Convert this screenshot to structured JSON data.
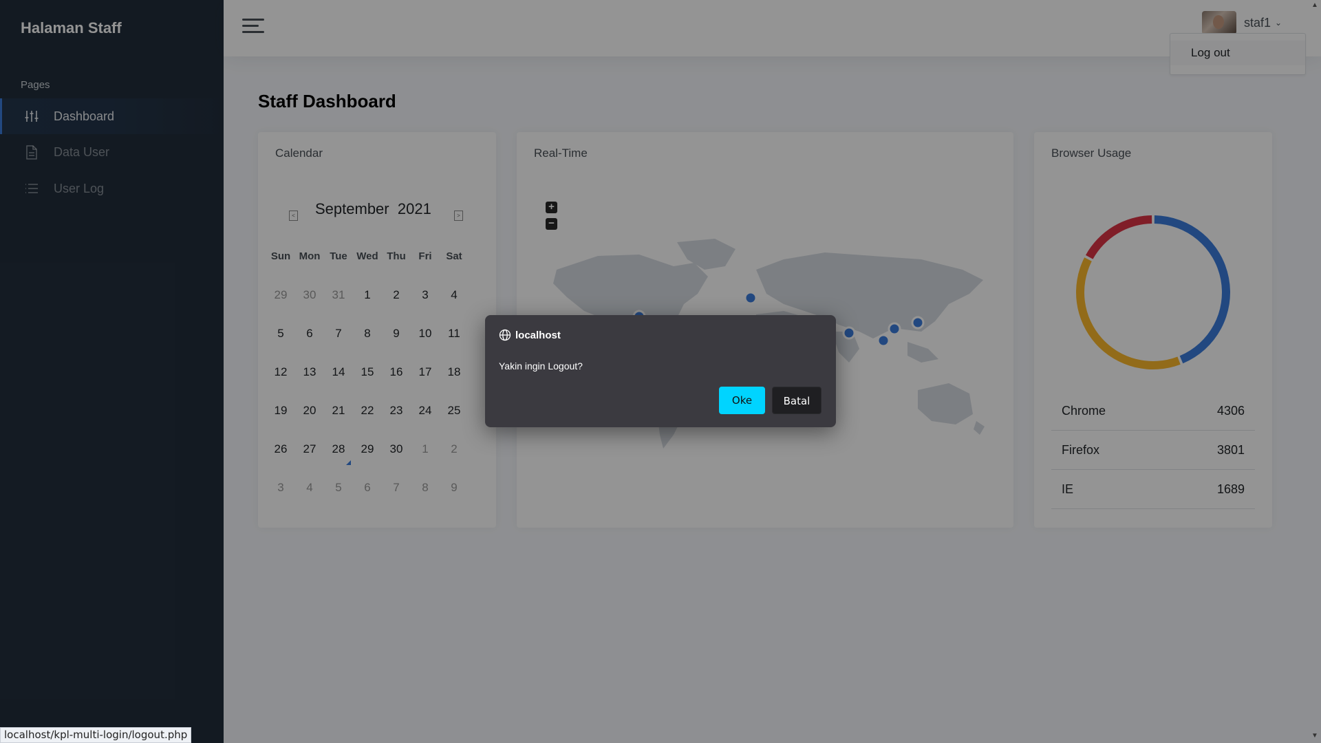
{
  "sidebar": {
    "brand": "Halaman Staff",
    "header": "Pages",
    "items": [
      {
        "label": "Dashboard",
        "icon": "sliders-icon"
      },
      {
        "label": "Data User",
        "icon": "file-icon"
      },
      {
        "label": "User Log",
        "icon": "list-icon"
      }
    ]
  },
  "topbar": {
    "user_name": "staf1",
    "dropdown": {
      "logout_label": "Log out"
    }
  },
  "main": {
    "title_bold": "Staff",
    "title_rest": "Dashboard",
    "calendar": {
      "title": "Calendar",
      "month": "September",
      "year": "2021",
      "weekdays": [
        "Sun",
        "Mon",
        "Tue",
        "Wed",
        "Thu",
        "Fri",
        "Sat"
      ],
      "weeks": [
        [
          "29",
          "30",
          "31",
          "1",
          "2",
          "3",
          "4"
        ],
        [
          "5",
          "6",
          "7",
          "8",
          "9",
          "10",
          "11"
        ],
        [
          "12",
          "13",
          "14",
          "15",
          "16",
          "17",
          "18"
        ],
        [
          "19",
          "20",
          "21",
          "22",
          "23",
          "24",
          "25"
        ],
        [
          "26",
          "27",
          "28",
          "29",
          "30",
          "1",
          "2"
        ],
        [
          "3",
          "4",
          "5",
          "6",
          "7",
          "8",
          "9"
        ]
      ],
      "today": "28"
    },
    "realtime": {
      "title": "Real-Time",
      "zoom_in": "+",
      "zoom_out": "−"
    },
    "browser_usage": {
      "title": "Browser Usage",
      "rows": [
        {
          "name": "Chrome",
          "value": "4306"
        },
        {
          "name": "Firefox",
          "value": "3801"
        },
        {
          "name": "IE",
          "value": "1689"
        }
      ],
      "colors": {
        "Chrome": "#3b7ddd",
        "Firefox": "#fcb92c",
        "IE": "#dc3545"
      }
    }
  },
  "dialog": {
    "origin": "localhost",
    "message": "Yakin ingin Logout?",
    "ok_label": "Oke",
    "cancel_label": "Batal"
  },
  "status_bar": {
    "url": "localhost/kpl-multi-login/logout.php"
  }
}
